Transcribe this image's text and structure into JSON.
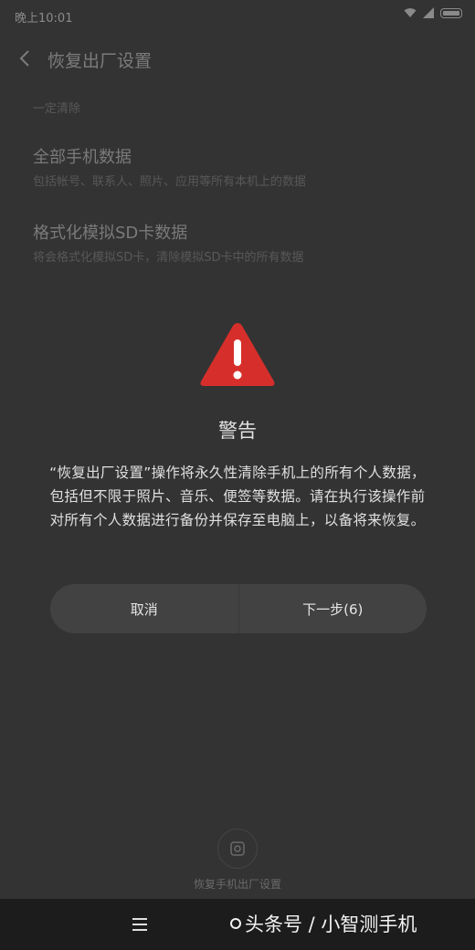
{
  "status_bar": {
    "time": "晚上10:01"
  },
  "header": {
    "title": "恢复出厂设置"
  },
  "section": {
    "label": "一定清除"
  },
  "options": [
    {
      "title": "全部手机数据",
      "description": "包括帐号、联系人、照片、应用等所有本机上的数据"
    },
    {
      "title": "格式化模拟SD卡数据",
      "description": "将会格式化模拟SD卡，清除模拟SD卡中的所有数据"
    }
  ],
  "dialog": {
    "title": "警告",
    "message": "“恢复出厂设置”操作将永久性清除手机上的所有个人数据，包括但不限于照片、音乐、便签等数据。请在执行该操作前对所有个人数据进行备份并保存至电脑上，以备将来恢复。",
    "cancel_label": "取消",
    "next_label": "下一步(6)"
  },
  "bottom_action": {
    "label": "恢复手机出厂设置"
  },
  "watermark": {
    "text": "头条号 / 小智测手机"
  },
  "colors": {
    "warning_red": "#d62f2b",
    "background": "#333333",
    "nav_bar": "#1c1c1c"
  }
}
